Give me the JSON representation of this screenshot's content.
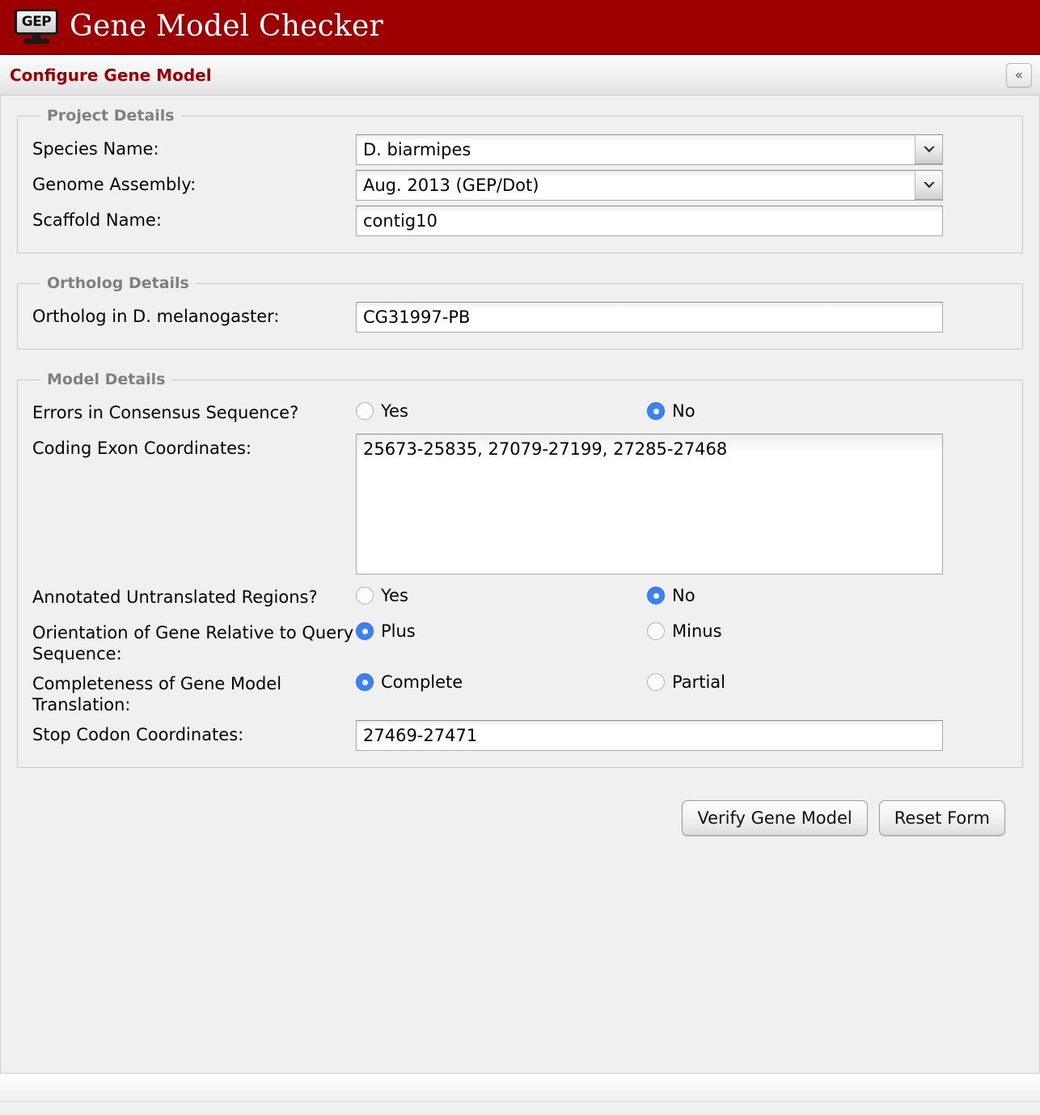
{
  "app": {
    "title": "Gene Model Checker",
    "logo_text": "GEP",
    "logo_icon": "monitor-icon",
    "header_color": "#9c0000"
  },
  "panel": {
    "title": "Configure Gene Model",
    "title_color": "#9c0000",
    "collapse_icon": "double-chevron-left-icon",
    "collapse_glyph": "«"
  },
  "sections": {
    "project_details": {
      "legend": "Project Details",
      "species_label": "Species Name:",
      "species_value": "D. biarmipes",
      "assembly_label": "Genome Assembly:",
      "assembly_value": "Aug. 2013 (GEP/Dot)",
      "scaffold_label": "Scaffold Name:",
      "scaffold_value": "contig10",
      "scaffold_placeholder": ""
    },
    "ortholog_details": {
      "legend": "Ortholog Details",
      "ortholog_label": "Ortholog in D. melanogaster:",
      "ortholog_value": "CG31997-PB",
      "ortholog_placeholder": ""
    },
    "model_details": {
      "legend": "Model Details",
      "errors_label": "Errors in Consensus Sequence?",
      "errors_yes": "Yes",
      "errors_no": "No",
      "errors_selected": "No",
      "exon_label": "Coding Exon Coordinates:",
      "exon_value": "25673-25835, 27079-27199, 27285-27468",
      "exon_placeholder": "",
      "utr_label": "Annotated Untranslated Regions?",
      "utr_yes": "Yes",
      "utr_no": "No",
      "utr_selected": "No",
      "orientation_label": "Orientation of Gene Relative to Query Sequence:",
      "orientation_plus": "Plus",
      "orientation_minus": "Minus",
      "orientation_selected": "Plus",
      "completeness_label": "Completeness of Gene Model Translation:",
      "completeness_complete": "Complete",
      "completeness_partial": "Partial",
      "completeness_selected": "Complete",
      "stop_codon_label": "Stop Codon Coordinates:",
      "stop_codon_value": "27469-27471",
      "stop_codon_placeholder": ""
    }
  },
  "buttons": {
    "verify_label": "Verify Gene Model",
    "reset_label": "Reset Form"
  },
  "colors": {
    "radio_selected": "#3b82f6",
    "legend_gray": "#808080",
    "page_background": "#f0f0f0"
  }
}
